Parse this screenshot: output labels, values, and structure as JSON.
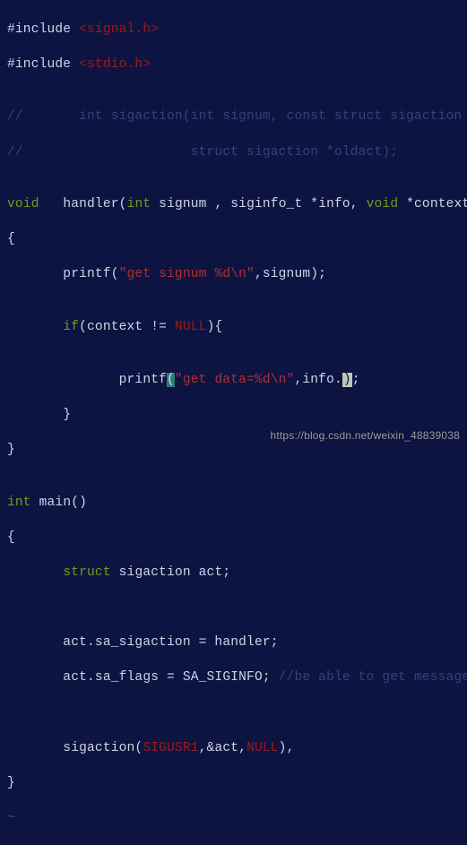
{
  "code": {
    "l01_a": "#include ",
    "l01_b": "<signal.h>",
    "l02_a": "#include ",
    "l02_b": "<stdio.h>",
    "l03": "",
    "l04": "//       int sigaction(int signum, const struct sigaction *act,",
    "l05": "//                     struct sigaction *oldact);",
    "l06": "",
    "l07_void": "void",
    "l07_sp1": "   ",
    "l07_fn": "handler",
    "l07_op": "(",
    "l07_int": "int",
    "l07_p1": " signum , siginfo_t *info, ",
    "l07_void2": "void",
    "l07_p2": " *context)",
    "l08": "{",
    "l09_a": "       printf(",
    "l09_str": "\"get signum %d\\n\"",
    "l09_c": ",signum);",
    "l10": "",
    "l11_a": "       ",
    "l11_if": "if",
    "l11_b": "(context != ",
    "l11_null": "NULL",
    "l11_c": "){",
    "l12": "",
    "l13_a": "              printf",
    "l13_op": "(",
    "l13_str": "\"get data=%d\\n\"",
    "l13_b": ",info.",
    "l13_cur": ")",
    "l13_c": ";",
    "l14": "       }",
    "l15": "}",
    "l16": "",
    "l17_int": "int",
    "l17_sp": " ",
    "l17_main": "main",
    "l17_b": "()",
    "l18": "{",
    "l19_a": "       ",
    "l19_struct": "struct",
    "l19_b": " sigaction act;",
    "l20": "",
    "l21": "",
    "l22": "       act.sa_sigaction = handler;",
    "l23_a": "       act.sa_flags = SA_SIGINFO; ",
    "l23_cmt": "//be able to get message",
    "l24": "",
    "l25": "",
    "l26_a": "       sigaction(",
    "l26_sig": "SIGUSR1",
    "l26_b": ",&act,",
    "l26_null": "NULL",
    "l26_c": "),",
    "l27": "}",
    "tilde": "~"
  },
  "watermark": "https://blog.csdn.net/weixin_48839038"
}
